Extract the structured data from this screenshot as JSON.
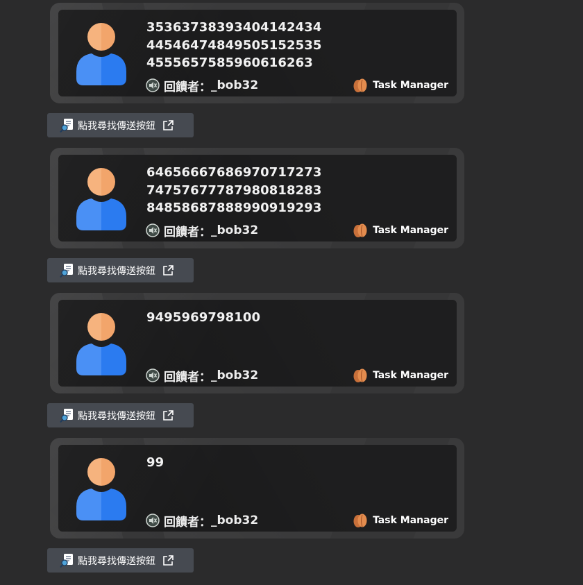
{
  "cards": [
    {
      "message": "353637383934041424344454647484950515253545556575859606162 63",
      "lines": [
        "35363738393404142434",
        "44546474849505152535",
        "45556575859606162 63"
      ],
      "reply_label": "回饋者：",
      "username": "_bob32",
      "brand_name": "Task Manager"
    },
    {
      "lines": [
        "64656667686970717273",
        "74757677787980818283",
        "84858687888990919293"
      ],
      "reply_label": "回饋者：",
      "username": "_bob32",
      "brand_name": "Task Manager"
    },
    {
      "lines": [
        "9495969798100",
        "",
        ""
      ],
      "reply_label": "回饋者：",
      "username": "_bob32",
      "brand_name": "Task Manager"
    },
    {
      "lines": [
        "99",
        "",
        ""
      ],
      "reply_label": "回饋者：",
      "username": "_bob32",
      "brand_name": "Task Manager"
    }
  ],
  "find_button": {
    "label": "點我尋找傳送按鈕"
  },
  "icons": {
    "avatar": "user-avatar-icon",
    "reply": "muted-speaker-icon",
    "brand": "almond-logo-icon",
    "find": "document-search-icon",
    "external": "external-link-icon"
  },
  "colors": {
    "background": "#2b2b2c",
    "card_inner": "#1e1e1f",
    "button": "#464a51",
    "avatar_head": "#f6b27a",
    "avatar_body": "#4a90f5"
  }
}
